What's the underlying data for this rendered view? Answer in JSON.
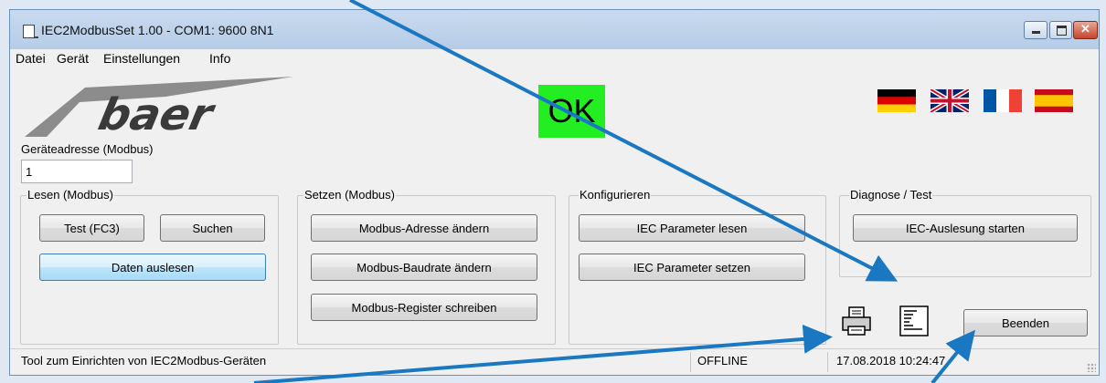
{
  "window": {
    "title": "IEC2ModbusSet 1.00 - COM1: 9600 8N1"
  },
  "menu": [
    "Datei",
    "Gerät",
    "Einstellungen",
    "Info"
  ],
  "logo_text": "baer",
  "status_indicator": {
    "text": "OK",
    "color": "#22ee22"
  },
  "flags": [
    "german-flag-icon",
    "uk-flag-icon",
    "french-flag-icon",
    "spanish-flag-icon"
  ],
  "address": {
    "label": "Geräteadresse (Modbus)",
    "value": "1"
  },
  "groups": {
    "lesen": {
      "label": "Lesen (Modbus)",
      "test_button": "Test (FC3)",
      "search_button": "Suchen",
      "read_data_button": "Daten auslesen"
    },
    "setzen": {
      "label": "Setzen (Modbus)",
      "change_address_button": "Modbus-Adresse ändern",
      "change_baudrate_button": "Modbus-Baudrate ändern",
      "write_register_button": "Modbus-Register schreiben"
    },
    "konfigurieren": {
      "label": "Konfigurieren",
      "read_params_button": "IEC Parameter lesen",
      "set_params_button": "IEC Parameter setzen"
    },
    "diagnose": {
      "label": "Diagnose / Test",
      "start_reading_button": "IEC-Auslesung starten"
    }
  },
  "icons": {
    "print": "printer-icon",
    "log": "log-document-icon"
  },
  "exit_button": "Beenden",
  "statusbar": {
    "message": "Tool zum Einrichten von IEC2Modbus-Geräten",
    "connection": "OFFLINE",
    "datetime": "17.08.2018 10:24:47"
  },
  "colors": {
    "annotation_arrow": "#1a78c2",
    "titlebar": "#c8daef",
    "ok_background": "#22ee22"
  }
}
